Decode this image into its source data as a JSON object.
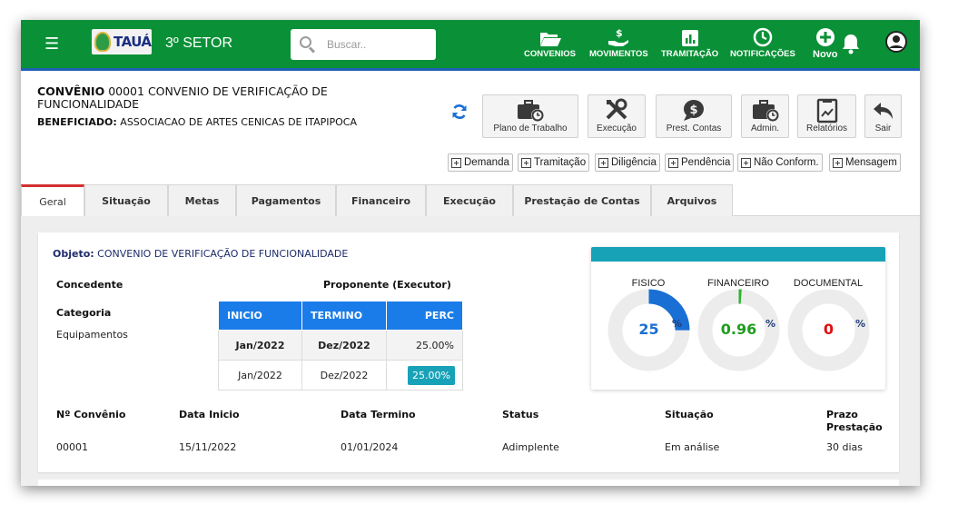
{
  "topbar": {
    "brand": "TAUÁ",
    "sector": "3º SETOR",
    "search_placeholder": "Buscar..",
    "nav": [
      {
        "label": "CONVENIOS",
        "icon": "folder-open-icon"
      },
      {
        "label": "MOVIMENTOS",
        "icon": "hand-money-icon"
      },
      {
        "label": "TRAMITAÇÃO",
        "icon": "bar-chart-icon"
      },
      {
        "label": "NOTIFICAÇÕES",
        "icon": "clock-icon"
      },
      {
        "label": "Novo",
        "icon": "plus-circle-icon"
      }
    ]
  },
  "header": {
    "convenio_label": "CONVÊNIO",
    "convenio_text": "00001 CONVENIO DE VERIFICAÇÃO DE FUNCIONALIDADE",
    "beneficiado_label": "BENEFICIADO:",
    "beneficiado_value": "ASSOCIACAO DE ARTES CENICAS DE ITAPIPOCA"
  },
  "toolbar": [
    {
      "label": "Plano de Trabalho",
      "icon": "briefcase-clock-icon"
    },
    {
      "label": "Execução",
      "icon": "tools-icon"
    },
    {
      "label": "Prest. Contas",
      "icon": "money-bubble-icon"
    },
    {
      "label": "Admin.",
      "icon": "briefcase-clock-icon"
    },
    {
      "label": "Relatórios",
      "icon": "report-icon"
    },
    {
      "label": "Sair",
      "icon": "undo-arrow-icon"
    }
  ],
  "subactions": [
    "Demanda",
    "Tramitação",
    "Diligência",
    "Pendência",
    "Não Conform.",
    "Mensagem"
  ],
  "tabs": [
    "Geral",
    "Situação",
    "Metas",
    "Pagamentos",
    "Financeiro",
    "Execução",
    "Prestação de Contas",
    "Arquivos"
  ],
  "geral": {
    "objeto_label": "Objeto:",
    "objeto_value": "CONVENIO DE VERIFICAÇÃO DE FUNCIONALIDADE",
    "concedente_label": "Concedente",
    "proponente_label": "Proponente (Executor)",
    "categoria_label": "Categoria",
    "categoria_value": "Equipamentos",
    "period_headers": [
      "INICIO",
      "TERMINO",
      "PERC"
    ],
    "period_rows": [
      [
        "Jan/2022",
        "Dez/2022",
        "25.00%"
      ],
      [
        "Jan/2022",
        "Dez/2022",
        "25.00%"
      ]
    ]
  },
  "indicators": [
    {
      "title": "FISICO",
      "value": "25",
      "fraction": 0.25,
      "color": "#1a6fd4",
      "value_color": "#1a6fd4",
      "pct": "%"
    },
    {
      "title": "FINANCEIRO",
      "value": "0.96",
      "fraction": 0.0096,
      "color": "#2bb52b",
      "value_color": "#1f9e1f",
      "pct": "%"
    },
    {
      "title": "DOCUMENTAL",
      "value": "0",
      "fraction": 0,
      "color": "#e01010",
      "value_color": "#e01010",
      "pct": "%"
    }
  ],
  "details": {
    "headers": [
      "Nº Convênio",
      "Data Inicio",
      "Data Termino",
      "Status",
      "Situação",
      "Prazo Prestação"
    ],
    "values": [
      "00001",
      "15/11/2022",
      "01/01/2024",
      "Adimplente",
      "Em análise",
      "30 dias"
    ]
  }
}
